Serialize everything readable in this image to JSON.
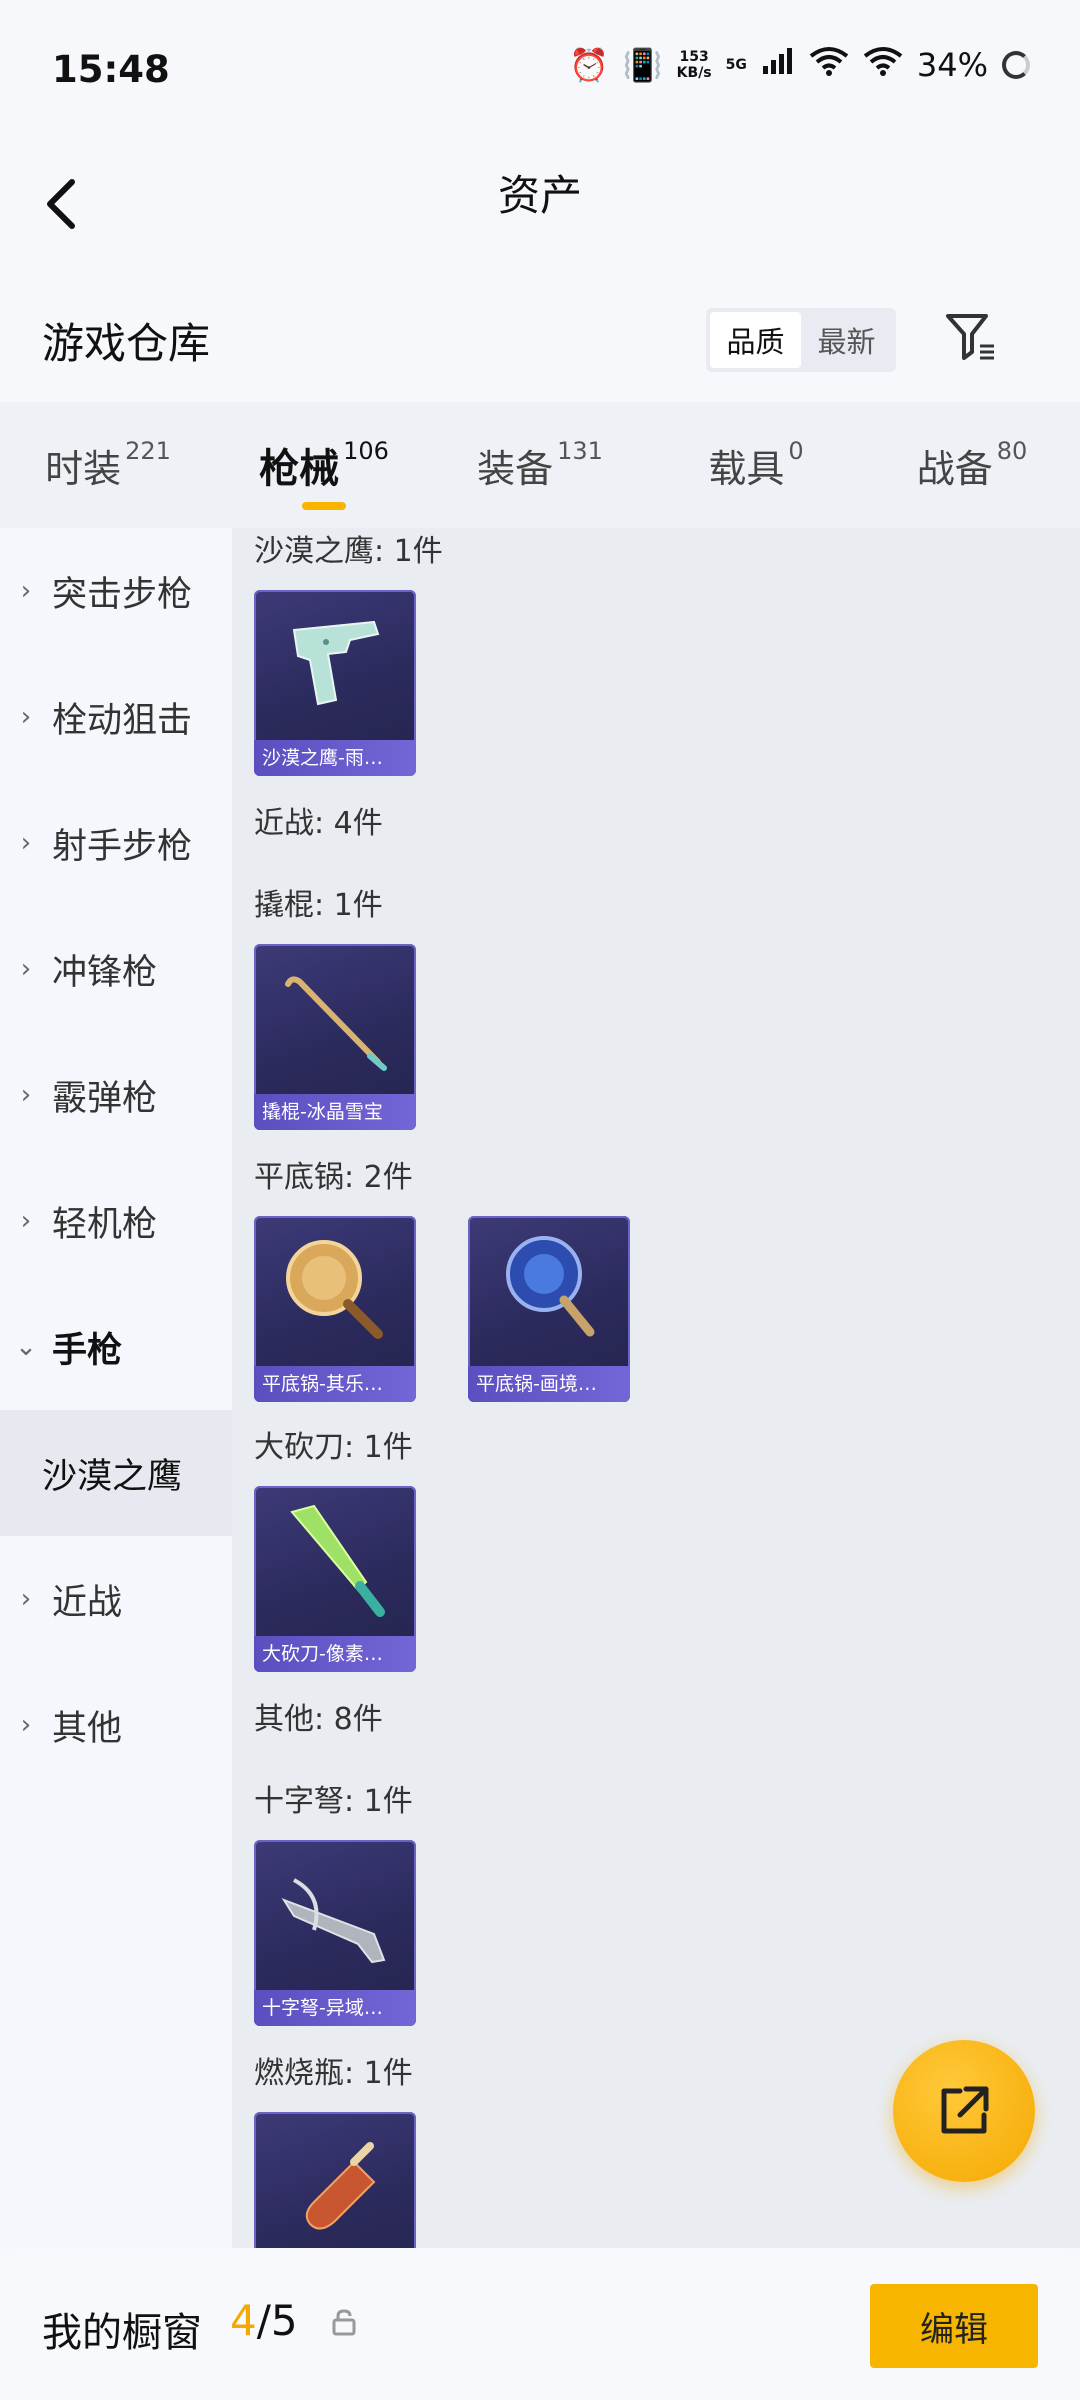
{
  "status_bar": {
    "time": "15:48",
    "net_speed_value": "153",
    "net_speed_unit": "KB/s",
    "network": "5G",
    "battery": "34%"
  },
  "header": {
    "title": "资产"
  },
  "warehouse": {
    "title": "游戏仓库",
    "sort_options": [
      "品质",
      "最新"
    ],
    "active_sort": "品质"
  },
  "tabs": [
    {
      "label": "时装",
      "count": "221"
    },
    {
      "label": "枪械",
      "count": "106",
      "active": true
    },
    {
      "label": "装备",
      "count": "131"
    },
    {
      "label": "载具",
      "count": "0"
    },
    {
      "label": "战备",
      "count": "80"
    }
  ],
  "sidebar": [
    {
      "label": "突击步枪"
    },
    {
      "label": "栓动狙击"
    },
    {
      "label": "射手步枪"
    },
    {
      "label": "冲锋枪"
    },
    {
      "label": "霰弹枪"
    },
    {
      "label": "轻机枪"
    },
    {
      "label": "手枪",
      "expanded": true
    },
    {
      "label": "沙漠之鹰",
      "selected": true
    },
    {
      "label": "近战"
    },
    {
      "label": "其他"
    }
  ],
  "content": {
    "sections": [
      {
        "label": "沙漠之鹰: 1件"
      },
      {
        "label": "近战: 4件"
      },
      {
        "label": "撬棍: 1件"
      },
      {
        "label": "平底锅: 2件"
      },
      {
        "label": "大砍刀: 1件"
      },
      {
        "label": "其他: 8件"
      },
      {
        "label": "十字弩: 1件"
      },
      {
        "label": "燃烧瓶: 1件"
      }
    ],
    "items": [
      {
        "caption": "沙漠之鹰-雨…",
        "icon": "desert-eagle-pistol-icon"
      },
      {
        "caption": "撬棍-冰晶雪宝",
        "icon": "crowbar-icon"
      },
      {
        "caption": "平底锅-其乐…",
        "icon": "frying-pan-gold-icon"
      },
      {
        "caption": "平底锅-画境…",
        "icon": "frying-pan-blue-icon"
      },
      {
        "caption": "大砍刀-像素…",
        "icon": "machete-icon"
      },
      {
        "caption": "十字弩-异域…",
        "icon": "crossbow-icon"
      },
      {
        "caption": "",
        "icon": "molotov-cocktail-icon"
      }
    ]
  },
  "bottom_bar": {
    "label": "我的橱窗",
    "current": "4",
    "separator_total": "/5",
    "edit_label": "编辑"
  },
  "colors": {
    "accent": "#f7b500",
    "card_bg": "#2b2a5c",
    "card_caption": "#6a5dd0"
  }
}
